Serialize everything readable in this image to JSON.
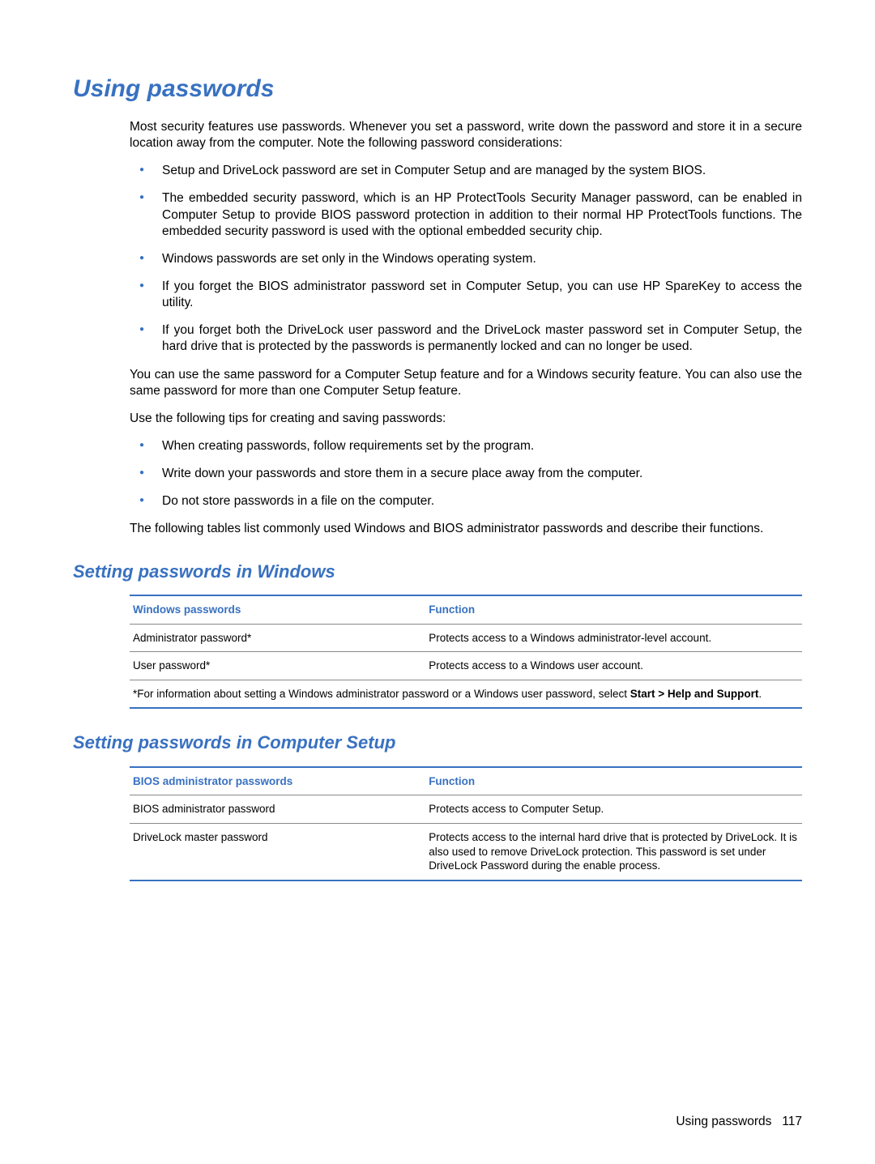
{
  "heading": "Using passwords",
  "intro": "Most security features use passwords. Whenever you set a password, write down the password and store it in a secure location away from the computer. Note the following password considerations:",
  "bullets1": [
    "Setup and DriveLock password are set in Computer Setup and are managed by the system BIOS.",
    "The embedded security password, which is an HP ProtectTools Security Manager password, can be enabled in Computer Setup to provide BIOS password protection in addition to their normal HP ProtectTools functions. The embedded security password is used with the optional embedded security chip.",
    "Windows passwords are set only in the Windows operating system.",
    "If you forget the BIOS administrator password set in Computer Setup, you can use HP SpareKey to access the utility.",
    "If you forget both the DriveLock user password and the DriveLock master password set in Computer Setup, the hard drive that is protected by the passwords is permanently locked and can no longer be used."
  ],
  "para_after_bullets1": "You can use the same password for a Computer Setup feature and for a Windows security feature. You can also use the same password for more than one Computer Setup feature.",
  "tips_intro": "Use the following tips for creating and saving passwords:",
  "bullets2": [
    "When creating passwords, follow requirements set by the program.",
    "Write down your passwords and store them in a secure place away from the computer.",
    "Do not store passwords in a file on the computer."
  ],
  "para_after_bullets2": "The following tables list commonly used Windows and BIOS administrator passwords and describe their functions.",
  "section_win": "Setting passwords in Windows",
  "table_win": {
    "head1": "Windows passwords",
    "head2": "Function",
    "rows": [
      {
        "c1": "Administrator password*",
        "c2": "Protects access to a Windows administrator-level account."
      },
      {
        "c1": "User password*",
        "c2": "Protects access to a Windows user account."
      }
    ],
    "footnote_pre": "*For information about setting a Windows administrator password or a Windows user password, select ",
    "footnote_bold": "Start > Help and Support",
    "footnote_post": "."
  },
  "section_cs": "Setting passwords in Computer Setup",
  "table_cs": {
    "head1": "BIOS administrator passwords",
    "head2": "Function",
    "rows": [
      {
        "c1": "BIOS administrator password",
        "c2": "Protects access to Computer Setup."
      },
      {
        "c1": "DriveLock master password",
        "c2": "Protects access to the internal hard drive that is protected by DriveLock. It is also used to remove DriveLock protection. This password is set under DriveLock Password during the enable process."
      }
    ]
  },
  "footer_label": "Using passwords",
  "footer_page": "117"
}
